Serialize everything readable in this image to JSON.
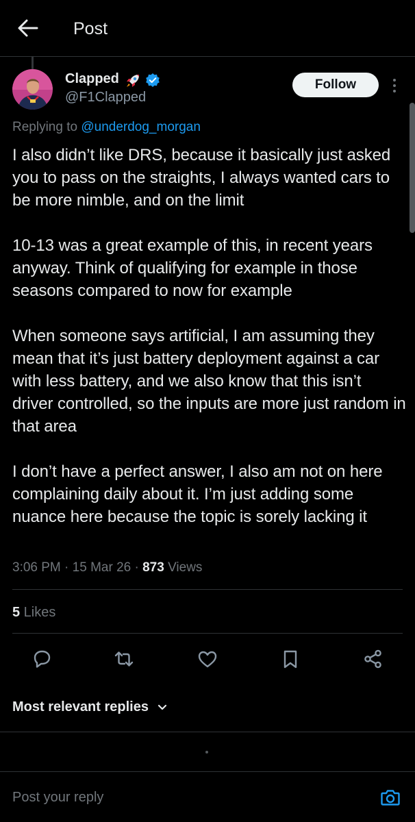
{
  "header": {
    "title": "Post",
    "back_icon": "arrow-left-icon"
  },
  "author": {
    "display_name": "Clapped",
    "name_emoji": "rocket-emoji",
    "verified_icon": "verified-badge-icon",
    "handle": "@F1Clapped"
  },
  "follow_label": "Follow",
  "replying": {
    "prefix": "Replying to ",
    "mention": "@underdog_morgan"
  },
  "tweet": {
    "paragraphs": [
      "I also didn’t like DRS, because it basically just asked you to pass on the straights,  I always wanted cars to be more nimble, and on the limit",
      "10-13 was a great example of this, in recent years anyway.  Think of qualifying for example in those seasons compared to now for example",
      "When someone says artificial, I am assuming they mean that it’s just battery deployment against a car with less battery, and we also know that this isn’t driver controlled, so the inputs are more just random in that area",
      "I don’t have a perfect answer, I also am not on here complaining daily about it. I’m just adding some nuance here because the topic is sorely lacking it"
    ]
  },
  "meta": {
    "time": "3:06 PM",
    "sep1": " · ",
    "date": "15 Mar 26",
    "sep2": " · ",
    "views_count": "873",
    "views_label": " Views"
  },
  "likes": {
    "count": "5",
    "label": " Likes"
  },
  "actions": {
    "reply_icon": "reply-icon",
    "repost_icon": "repost-icon",
    "like_icon": "heart-icon",
    "bookmark_icon": "bookmark-icon",
    "share_icon": "share-icon"
  },
  "replies_sort_label": "Most relevant replies",
  "reply_box": {
    "placeholder": "Post your reply"
  },
  "colors": {
    "accent": "#1d9bf0",
    "background": "#000000",
    "text": "#e7e9ea",
    "muted": "#71767b",
    "border": "#2f3336"
  }
}
